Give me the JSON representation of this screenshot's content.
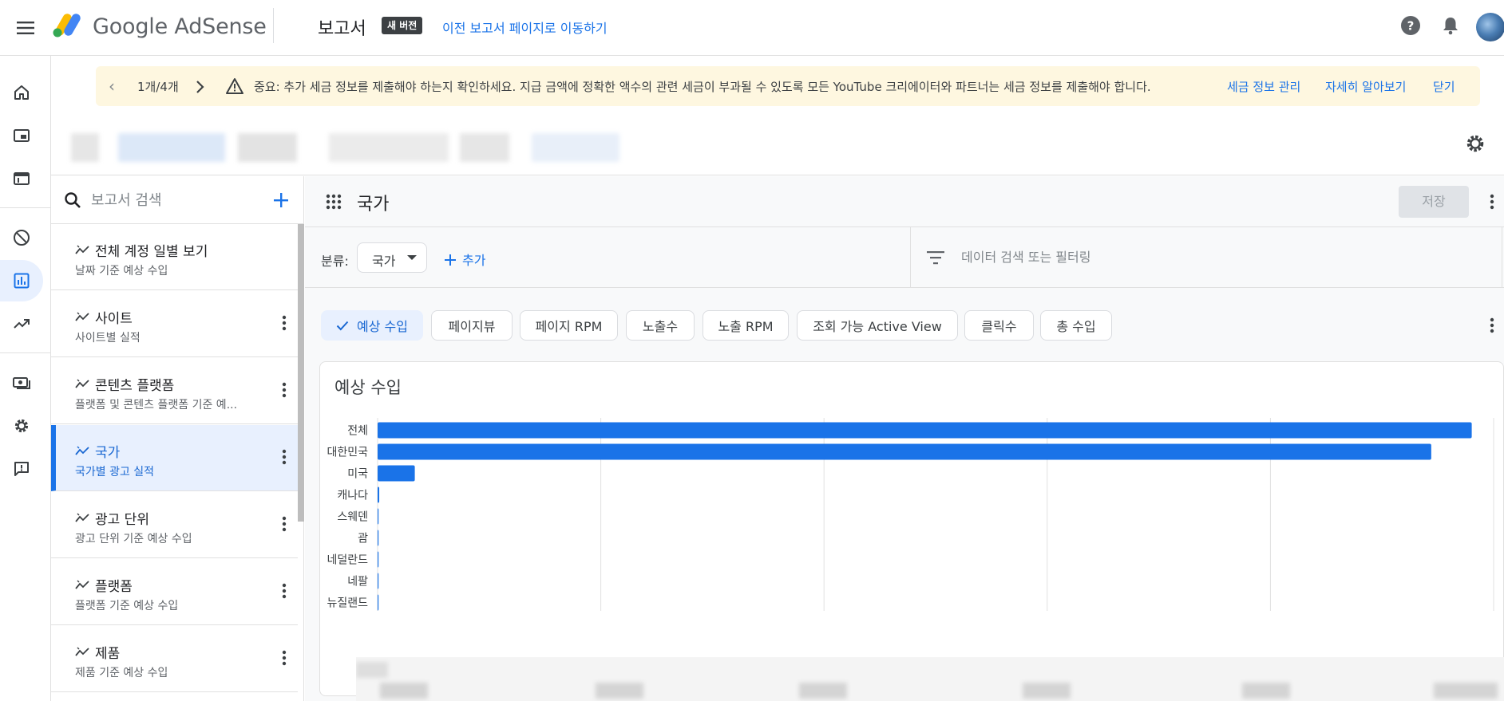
{
  "topbar": {
    "brand": "Google AdSense",
    "page_title": "보고서",
    "new_badge": "새 버전",
    "old_report_link": "이전 보고서 페이지로 이동하기"
  },
  "banner": {
    "counter": "1개/4개",
    "message": "중요: 추가 세금 정보를 제출해야 하는지 확인하세요. 지급 금액에 정확한 액수의 관련 세금이 부과될 수 있도록 모든 YouTube 크리에이터와 파트너는 세금 정보를 제출해야 합니다.",
    "links": [
      "세금 정보 관리",
      "자세히 알아보기",
      "닫기"
    ]
  },
  "report_list": {
    "search_placeholder": "보고서 검색",
    "items": [
      {
        "title": "전체 계정 일별 보기",
        "subtitle": "날짜 기준 예상 수입"
      },
      {
        "title": "사이트",
        "subtitle": "사이트별 실적"
      },
      {
        "title": "콘텐츠 플랫폼",
        "subtitle": "플랫폼 및 콘텐츠 플랫폼 기준 예..."
      },
      {
        "title": "국가",
        "subtitle": "국가별 광고 실적"
      },
      {
        "title": "광고 단위",
        "subtitle": "광고 단위 기준 예상 수입"
      },
      {
        "title": "플랫폼",
        "subtitle": "플랫폼 기준 예상 수입"
      },
      {
        "title": "제품",
        "subtitle": "제품 기준 예상 수입"
      }
    ]
  },
  "report": {
    "title": "국가",
    "save_label": "저장",
    "dims_label": "분류:",
    "dimension": "국가",
    "add_label": "추가",
    "filter_placeholder": "데이터 검색 또는 필터링",
    "metrics": [
      "예상 수입",
      "페이지뷰",
      "페이지 RPM",
      "노출수",
      "노출 RPM",
      "조회 가능 Active View",
      "클릭수",
      "총 수입"
    ],
    "selected_metric": "예상 수입",
    "chart_title": "예상 수입"
  },
  "colors": {
    "accent": "#1a73e8",
    "bar": "#1a73e8",
    "selected_bg": "#e8f0fe",
    "banner_bg": "#fef7e0"
  },
  "chart_data": {
    "type": "bar",
    "orientation": "horizontal",
    "title": "예상 수입",
    "categories": [
      "전체",
      "대한민국",
      "미국",
      "캐나다",
      "스웨덴",
      "괌",
      "네덜란드",
      "네팔",
      "뉴질랜드"
    ],
    "values": [
      100,
      96.3,
      3.4,
      0.15,
      0.04,
      0.03,
      0.02,
      0.01,
      0.01
    ],
    "value_unit": "% of 전체 (axis tick labels not legible)",
    "xlim": [
      0,
      102
    ],
    "grid": true
  }
}
